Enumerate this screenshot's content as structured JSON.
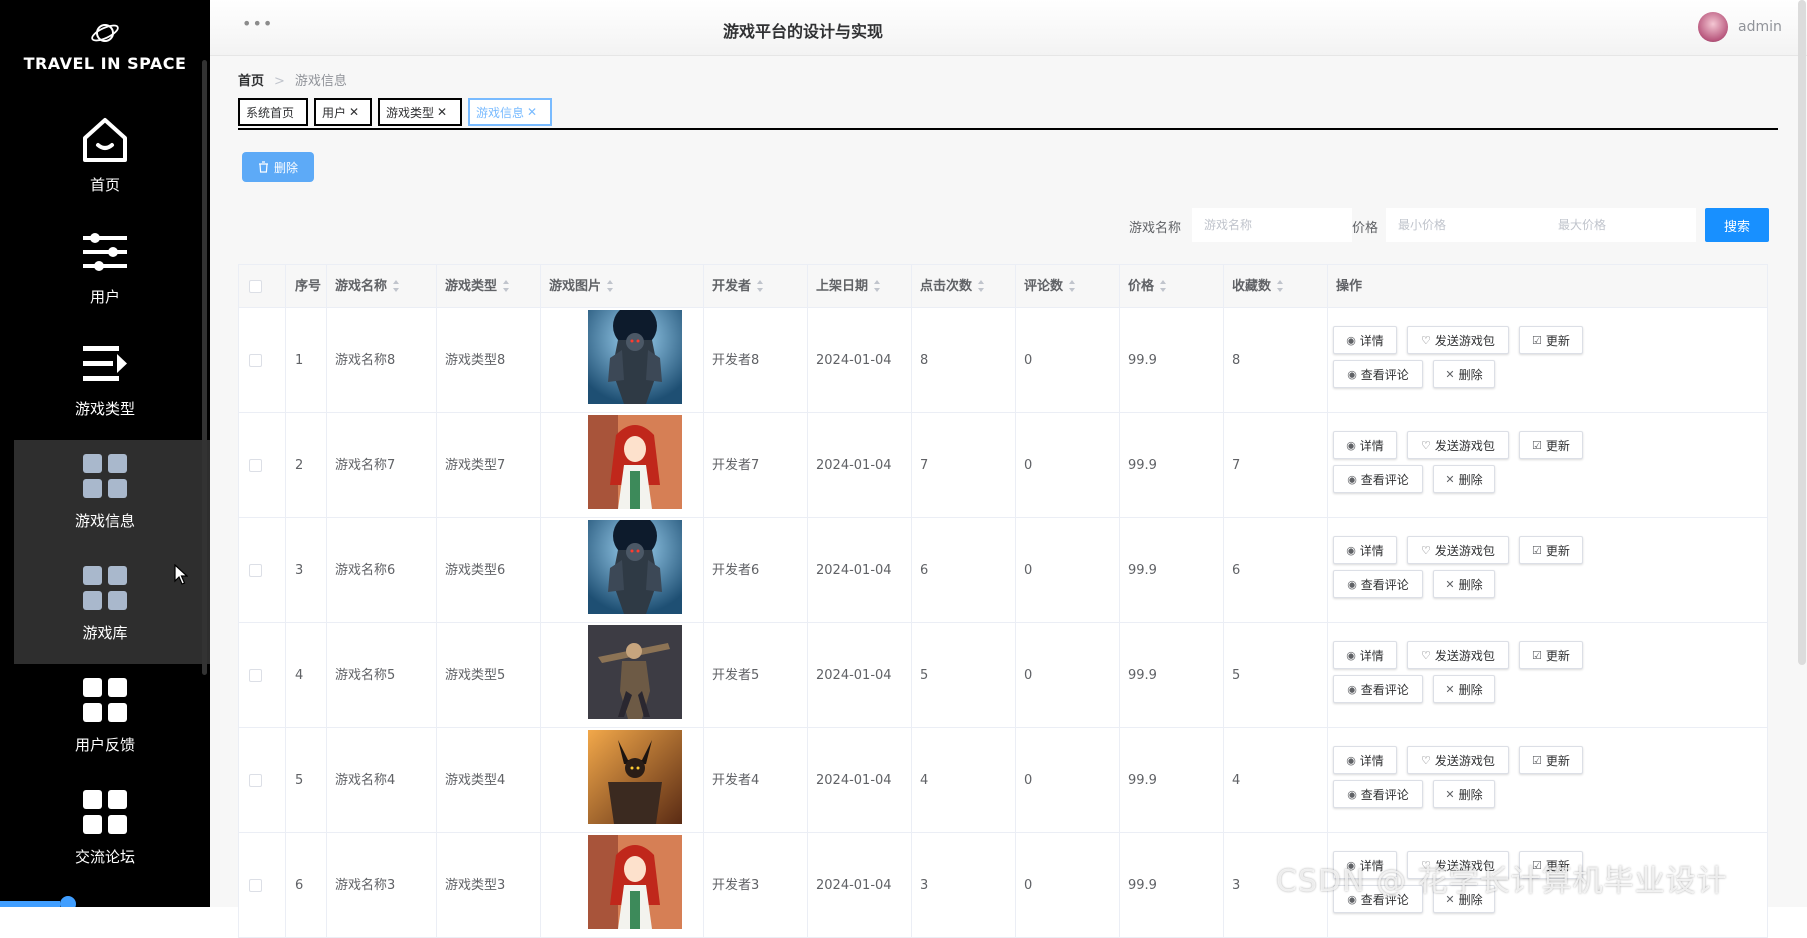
{
  "sidebar": {
    "brand": "TRAVEL IN SPACE",
    "items": [
      {
        "label": "首页",
        "icon": "home-icon"
      },
      {
        "label": "用户",
        "icon": "sliders-icon"
      },
      {
        "label": "游戏类型",
        "icon": "list-arrow-icon"
      },
      {
        "label": "游戏信息",
        "icon": "grid-icon"
      },
      {
        "label": "游戏库",
        "icon": "grid-icon"
      },
      {
        "label": "用户反馈",
        "icon": "grid-icon"
      },
      {
        "label": "交流论坛",
        "icon": "grid-icon"
      }
    ]
  },
  "header": {
    "title": "游戏平台的设计与实现",
    "user": "admin",
    "menu_dots": "•••"
  },
  "breadcrumb": {
    "home": "首页",
    "separator": ">",
    "current": "游戏信息"
  },
  "tabs": [
    {
      "label": "系统首页",
      "closable": false
    },
    {
      "label": "用户",
      "closable": true
    },
    {
      "label": "游戏类型",
      "closable": true
    },
    {
      "label": "游戏信息",
      "closable": true,
      "active": true
    }
  ],
  "toolbar": {
    "delete_label": "删除"
  },
  "search": {
    "name_label": "游戏名称",
    "name_placeholder": "游戏名称",
    "price_label": "价格",
    "min_placeholder": "最小价格",
    "max_placeholder": "最大价格",
    "search_label": "搜索"
  },
  "table": {
    "columns": [
      "序号",
      "游戏名称",
      "游戏类型",
      "游戏图片",
      "开发者",
      "上架日期",
      "点击次数",
      "评论数",
      "价格",
      "收藏数",
      "操作"
    ],
    "actions": {
      "detail": "详情",
      "send": "发送游戏包",
      "update": "更新",
      "comments": "查看评论",
      "delete": "删除"
    },
    "rows": [
      {
        "no": "1",
        "name": "游戏名称8",
        "type": "游戏类型8",
        "image": "armored-knight",
        "developer": "开发者8",
        "date": "2024-01-04",
        "clicks": "8",
        "comments": "0",
        "price": "99.9",
        "favorites": "8"
      },
      {
        "no": "2",
        "name": "游戏名称7",
        "type": "游戏类型7",
        "image": "red-hair-girl",
        "developer": "开发者7",
        "date": "2024-01-04",
        "clicks": "7",
        "comments": "0",
        "price": "99.9",
        "favorites": "7"
      },
      {
        "no": "3",
        "name": "游戏名称6",
        "type": "游戏类型6",
        "image": "armored-knight",
        "developer": "开发者6",
        "date": "2024-01-04",
        "clicks": "6",
        "comments": "0",
        "price": "99.9",
        "favorites": "6"
      },
      {
        "no": "4",
        "name": "游戏名称5",
        "type": "游戏类型5",
        "image": "gunslinger",
        "developer": "开发者5",
        "date": "2024-01-04",
        "clicks": "5",
        "comments": "0",
        "price": "99.9",
        "favorites": "5"
      },
      {
        "no": "5",
        "name": "游戏名称4",
        "type": "游戏类型4",
        "image": "dark-warrior",
        "developer": "开发者4",
        "date": "2024-01-04",
        "clicks": "4",
        "comments": "0",
        "price": "99.9",
        "favorites": "4"
      },
      {
        "no": "6",
        "name": "游戏名称3",
        "type": "游戏类型3",
        "image": "red-hair-girl",
        "developer": "开发者3",
        "date": "2024-01-04",
        "clicks": "3",
        "comments": "0",
        "price": "99.9",
        "favorites": "3"
      }
    ]
  },
  "watermark": "CSDN @ 花学长计算机毕业设计",
  "colors": {
    "sidebar_bg": "#000000",
    "primary": "#1890ff",
    "delete_btn": "#5daaf7",
    "active_tab": "#79bbff"
  }
}
